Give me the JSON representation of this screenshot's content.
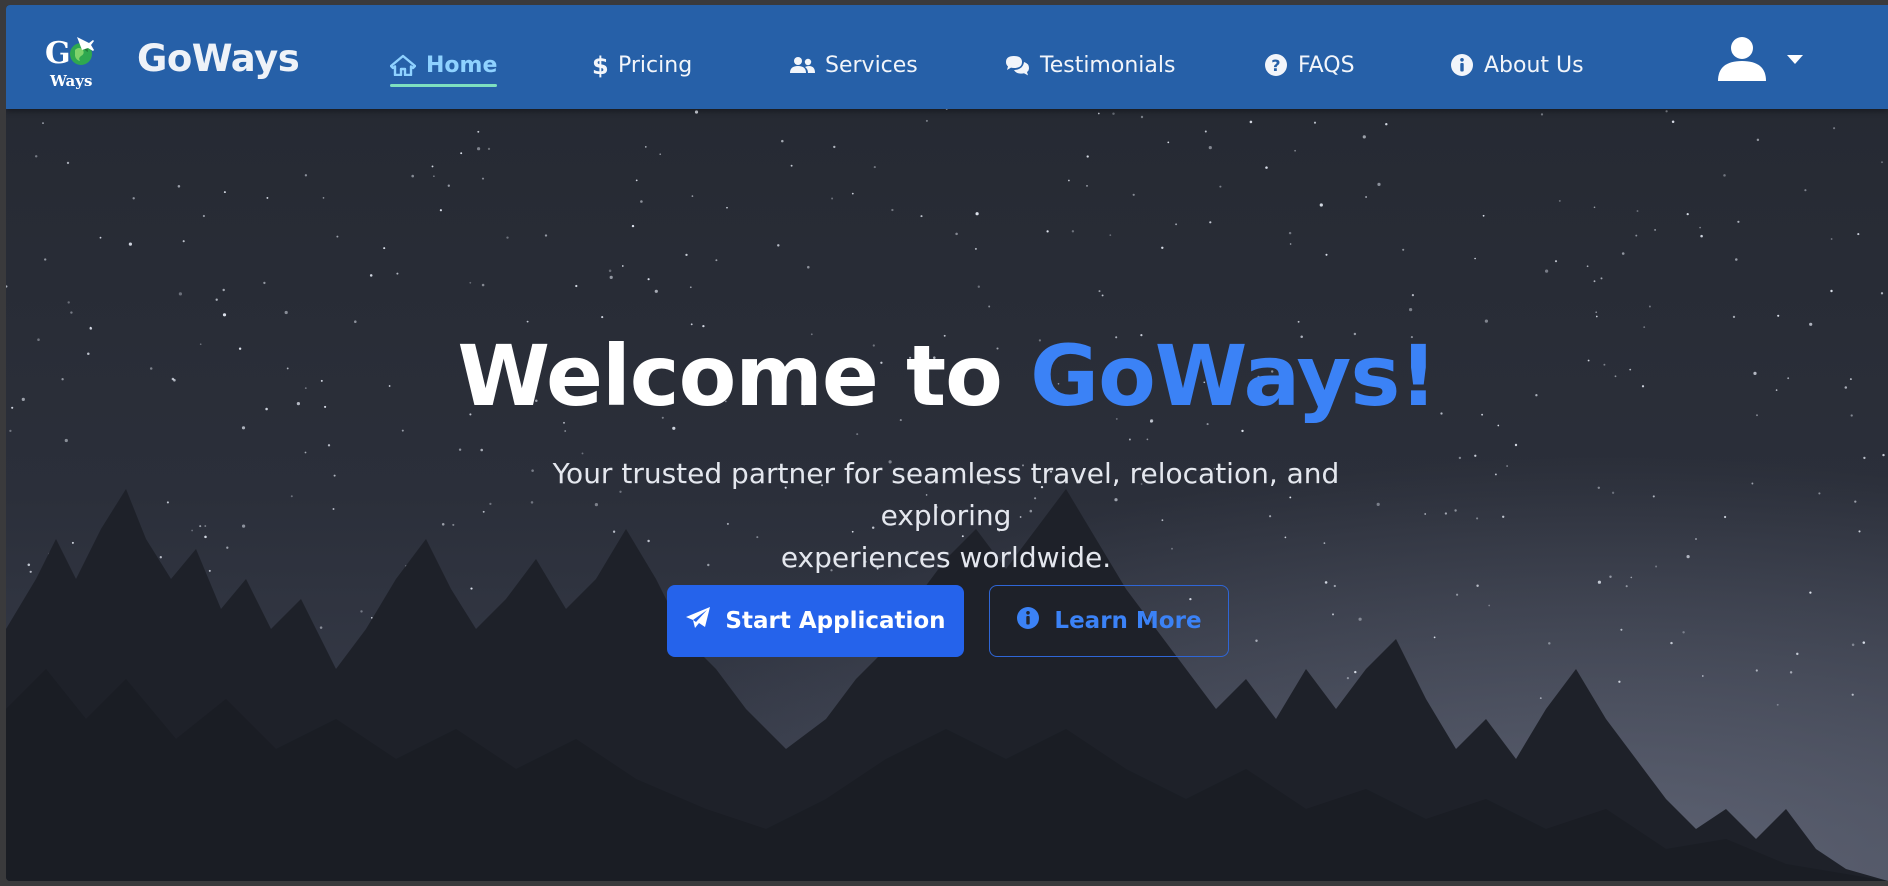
{
  "brand": {
    "logo_icon": "goways-globe-plane-logo",
    "logo_text_top": "GO",
    "logo_text_bottom": "Ways",
    "name": "GoWays"
  },
  "nav": {
    "items": [
      {
        "label": "Home",
        "icon": "home-icon",
        "active": true
      },
      {
        "label": "Pricing",
        "icon": "dollar-icon",
        "active": false
      },
      {
        "label": "Services",
        "icon": "users-icon",
        "active": false
      },
      {
        "label": "Testimonials",
        "icon": "comments-icon",
        "active": false
      },
      {
        "label": "FAQS",
        "icon": "question-circle-icon",
        "active": false
      },
      {
        "label": "About Us",
        "icon": "info-circle-icon",
        "active": false
      }
    ],
    "user_menu": {
      "icon": "user-icon",
      "dropdown_icon": "caret-down-icon"
    }
  },
  "hero": {
    "title_prefix": "Welcome to ",
    "title_accent": "GoWays!",
    "subtitle_line1": "Your trusted partner for seamless travel, relocation, and exploring",
    "subtitle_line2": "experiences worldwide.",
    "primary_button": {
      "label": "Start Application",
      "icon": "paper-plane-icon"
    },
    "secondary_button": {
      "label": "Learn More",
      "icon": "info-circle-icon"
    }
  },
  "colors": {
    "navbar": "#2660a8",
    "accent": "#3b82f6",
    "primary_button": "#2563eb",
    "active_nav": "#8fd2ff",
    "active_underline": "#7ee0c0",
    "hero_bg": "#23262e"
  }
}
